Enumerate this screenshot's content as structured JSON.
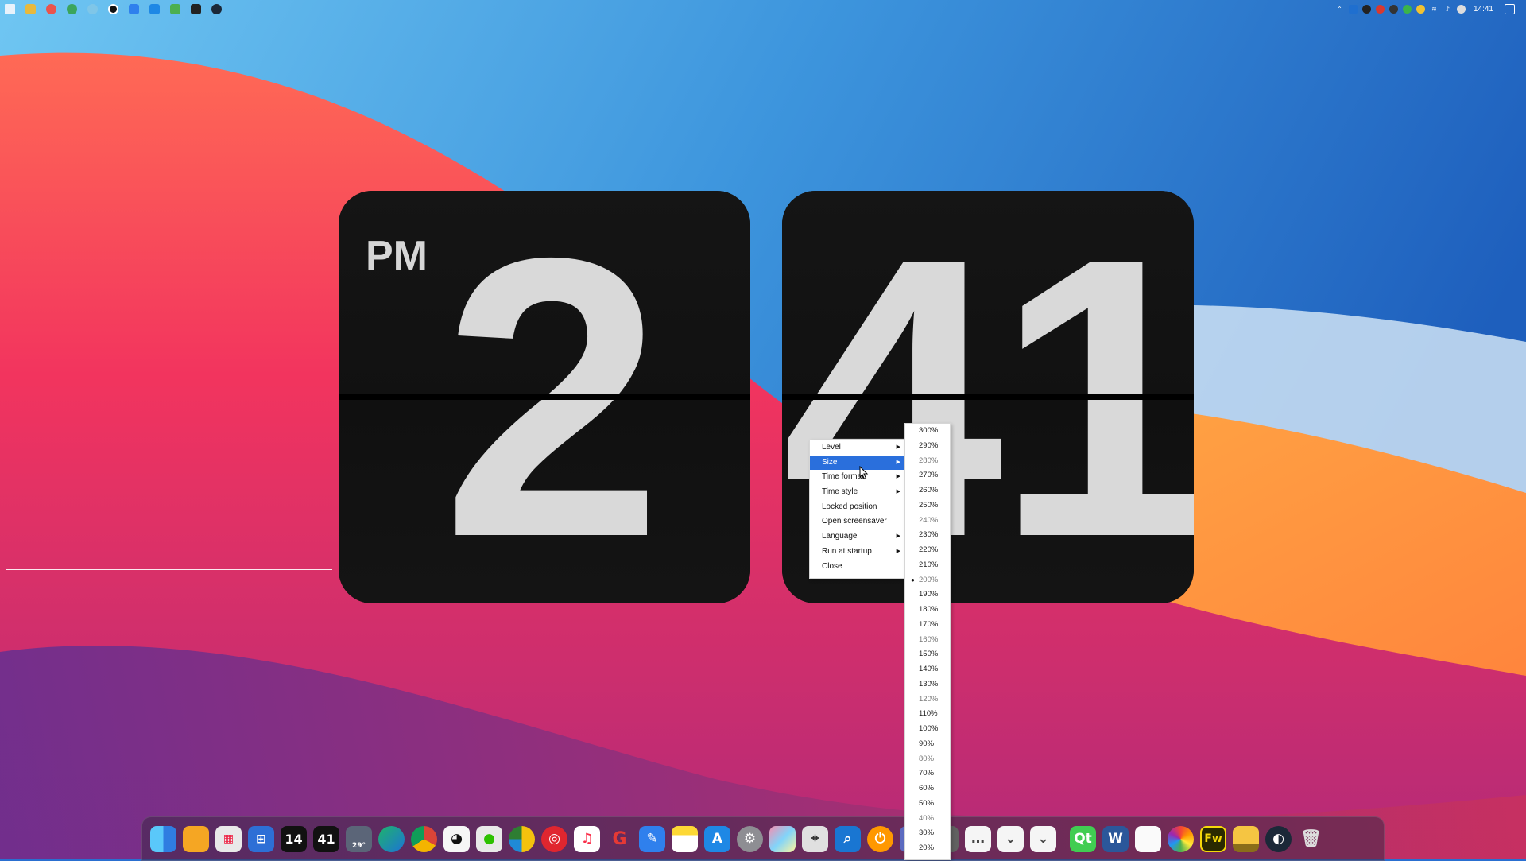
{
  "clock": {
    "ampm": "PM",
    "hour": "2",
    "minute": "41"
  },
  "context_menu": {
    "items": [
      {
        "label": "Level",
        "has_submenu": true
      },
      {
        "label": "Size",
        "has_submenu": true,
        "selected": true
      },
      {
        "label": "Time format",
        "has_submenu": true
      },
      {
        "label": "Time style",
        "has_submenu": true
      },
      {
        "label": "Locked position",
        "has_submenu": false
      },
      {
        "label": "Open screensaver",
        "has_submenu": false
      },
      {
        "label": "Language",
        "has_submenu": true
      },
      {
        "label": "Run at startup",
        "has_submenu": true
      },
      {
        "label": "Close",
        "has_submenu": false
      }
    ]
  },
  "size_menu": {
    "options": [
      "300%",
      "290%",
      "280%",
      "270%",
      "260%",
      "250%",
      "240%",
      "230%",
      "220%",
      "210%",
      "200%",
      "190%",
      "180%",
      "170%",
      "160%",
      "150%",
      "140%",
      "130%",
      "120%",
      "110%",
      "100%",
      "90%",
      "80%",
      "70%",
      "60%",
      "50%",
      "40%",
      "30%",
      "20%"
    ],
    "checked": "200%"
  },
  "menubar": {
    "time": "14:41"
  },
  "dock": {
    "calendar_day": "14",
    "minute_widget": "41",
    "weather_temp": "29°"
  },
  "colors": {
    "menu_highlight": "#2a6fdc",
    "clock_card": "#141414",
    "clock_digit": "#d9d9d9"
  }
}
